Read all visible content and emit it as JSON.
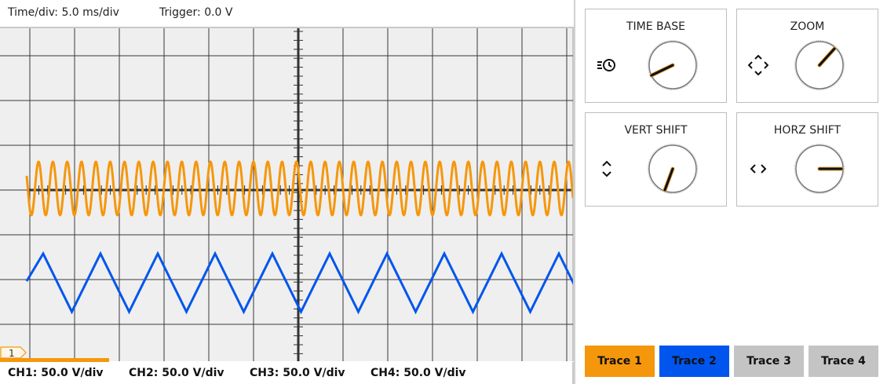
{
  "header": {
    "time_div": "Time/div: 5.0 ms/div",
    "trigger": "Trigger: 0.0 V"
  },
  "scope": {
    "marker_label": "1",
    "trace_colors": {
      "orange": "#f5970c",
      "blue": "#0055ee"
    }
  },
  "channels": [
    {
      "label": "CH1: 50.0 V/div"
    },
    {
      "label": "CH2: 50.0 V/div"
    },
    {
      "label": "CH3: 50.0 V/div"
    },
    {
      "label": "CH4: 50.0 V/div"
    }
  ],
  "knobs": [
    {
      "title": "TIME BASE",
      "icon": "time-base-clock-icon"
    },
    {
      "title": "ZOOM",
      "icon": "zoom-arrows-icon"
    },
    {
      "title": "VERT SHIFT",
      "icon": "vertical-arrows-icon"
    },
    {
      "title": "HORZ SHIFT",
      "icon": "horizontal-arrows-icon"
    }
  ],
  "traces": [
    {
      "label": "Trace 1",
      "color": "#f5970c",
      "active": true
    },
    {
      "label": "Trace 2",
      "color": "#0055ee",
      "active": true
    },
    {
      "label": "Trace 3",
      "color": "#c4c4c4",
      "active": false
    },
    {
      "label": "Trace 4",
      "color": "#c4c4c4",
      "active": false
    }
  ]
}
